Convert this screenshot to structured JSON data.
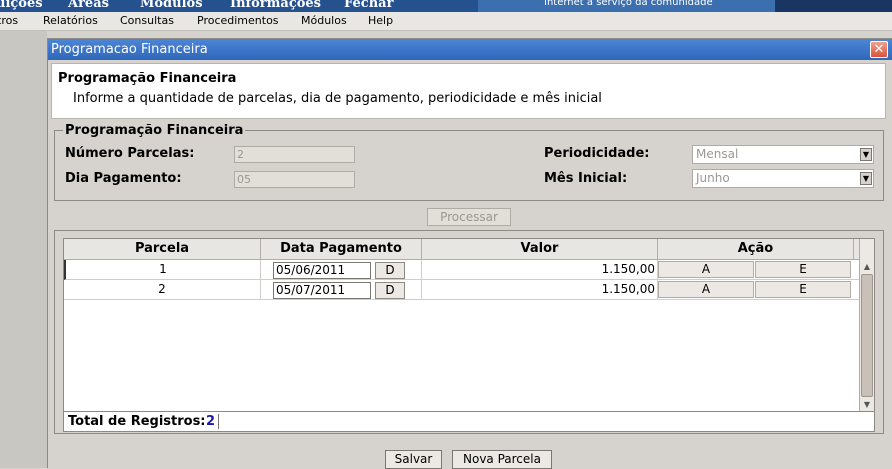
{
  "top_nav": {
    "items": [
      "uições",
      "Áreas",
      "Módulos",
      "Informações",
      "Fechar"
    ],
    "tagline": "Internet a serviço da comunidade"
  },
  "menu": {
    "items": [
      "tros",
      "Relatórios",
      "Consultas",
      "Procedimentos",
      "Módulos",
      "Help"
    ]
  },
  "dialog": {
    "title": "Programacao Financeira",
    "close_glyph": "✕",
    "header_title": "Programação Financeira",
    "header_desc": "Informe a quantidade de parcelas, dia de pagamento, periodicidade e mês inicial"
  },
  "form": {
    "legend": "Programação Financeira",
    "numero_parcelas_label": "Número Parcelas:",
    "numero_parcelas_value": "2",
    "dia_pagamento_label": "Dia Pagamento:",
    "dia_pagamento_value": "05",
    "periodicidade_label": "Periodicidade:",
    "periodicidade_value": "Mensal",
    "mes_inicial_label": "Mês Inicial:",
    "mes_inicial_value": "Junho",
    "processar_label": "Processar"
  },
  "grid": {
    "headers": [
      "Parcela",
      "Data Pagamento",
      "Valor",
      "Ação"
    ],
    "rows": [
      {
        "parcela": "1",
        "data": "05/06/2011",
        "d_label": "D",
        "valor": "1.150,00",
        "a_label": "A",
        "e_label": "E"
      },
      {
        "parcela": "2",
        "data": "05/07/2011",
        "d_label": "D",
        "valor": "1.150,00",
        "a_label": "A",
        "e_label": "E"
      }
    ],
    "total_label": "Total de Registros:",
    "total_value": "2"
  },
  "buttons": {
    "salvar": "Salvar",
    "nova_parcela": "Nova Parcela"
  },
  "colors": {
    "title_bar": "#2f67ba",
    "top_bar": "#25528f",
    "total_value": "#1a1aa6"
  }
}
